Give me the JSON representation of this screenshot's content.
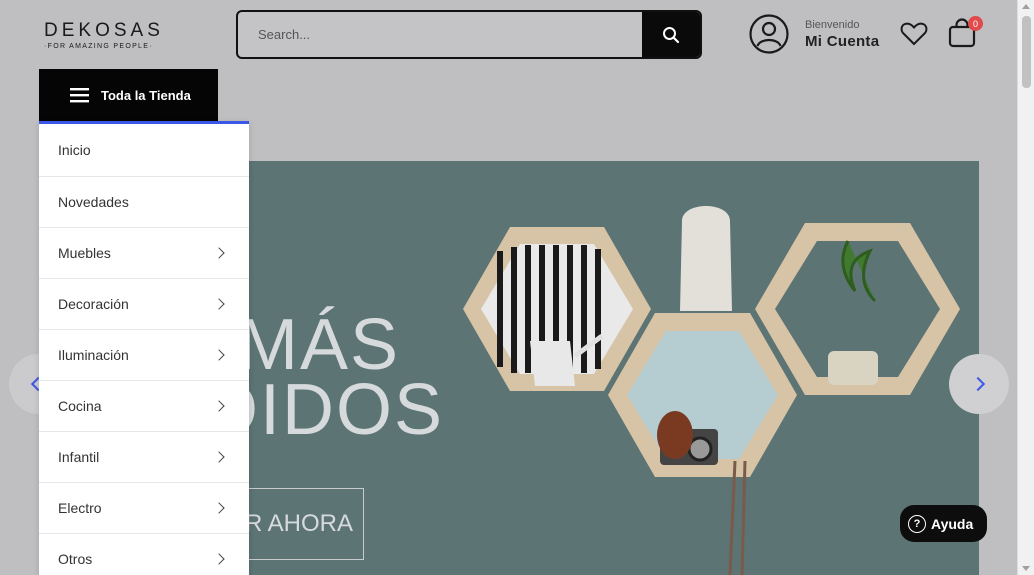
{
  "header": {
    "logo_name": "DEKOSAS",
    "logo_tagline": "·FOR AMAZING PEOPLE·",
    "search_placeholder": "Search...",
    "welcome": "Bienvenido",
    "account": "Mi Cuenta",
    "cart_count": "0"
  },
  "nav": {
    "store_button": "Toda la Tienda",
    "items": [
      {
        "label": "Inicio",
        "has_submenu": false
      },
      {
        "label": "Novedades",
        "has_submenu": false
      },
      {
        "label": "Muebles",
        "has_submenu": true
      },
      {
        "label": "Decoración",
        "has_submenu": true
      },
      {
        "label": "Iluminación",
        "has_submenu": true
      },
      {
        "label": "Cocina",
        "has_submenu": true
      },
      {
        "label": "Infantil",
        "has_submenu": true
      },
      {
        "label": "Electro",
        "has_submenu": true
      },
      {
        "label": "Otros",
        "has_submenu": true
      }
    ]
  },
  "banner": {
    "line1": "MÁS",
    "line2": "OIDOS",
    "cta": "R AHORA",
    "background_color": "#5c7474"
  },
  "help": {
    "label": "Ayuda"
  },
  "colors": {
    "accent": "#3c56e6",
    "badge": "#e04b4b"
  }
}
